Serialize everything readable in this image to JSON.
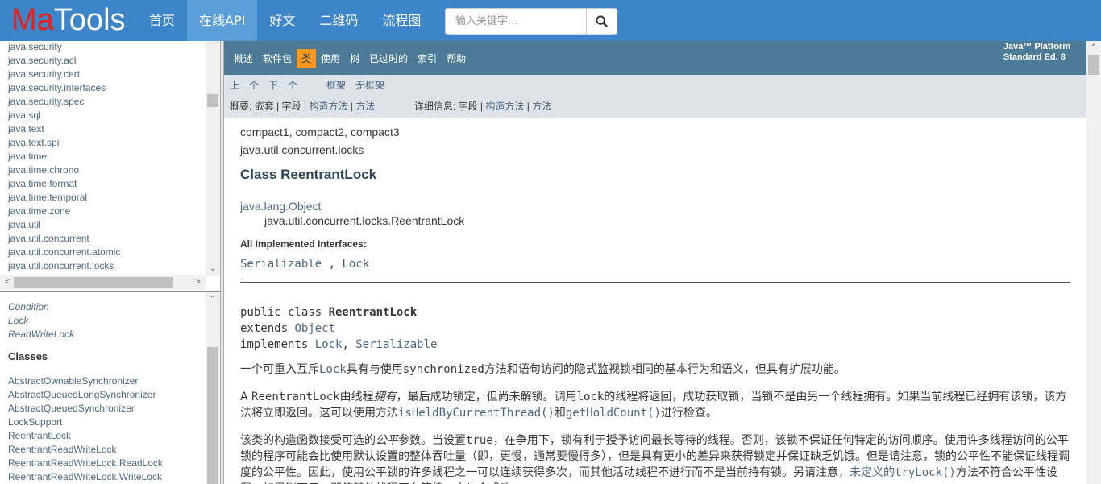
{
  "logo": {
    "ma": "Ma",
    "tools": "Tools"
  },
  "nav": {
    "items": [
      {
        "label": "首页"
      },
      {
        "label": "在线API"
      },
      {
        "label": "好文"
      },
      {
        "label": "二维码"
      },
      {
        "label": "流程图"
      }
    ],
    "active_index": 1
  },
  "search": {
    "placeholder": "输入关键字...",
    "icon": "search-icon"
  },
  "packages": [
    "java.security",
    "java.security.acl",
    "java.security.cert",
    "java.security.interfaces",
    "java.security.spec",
    "java.sql",
    "java.text",
    "java.text.spi",
    "java.time",
    "java.time.chrono",
    "java.time.format",
    "java.time.temporal",
    "java.time.zone",
    "java.util",
    "java.util.concurrent",
    "java.util.concurrent.atomic",
    "java.util.concurrent.locks"
  ],
  "interfaces": [
    "Condition",
    "Lock",
    "ReadWriteLock"
  ],
  "classes_heading": "Classes",
  "classes": [
    "AbstractOwnableSynchronizer",
    "AbstractQueuedLongSynchronizer",
    "AbstractQueuedSynchronizer",
    "LockSupport",
    "ReentrantLock",
    "ReentrantReadWriteLock",
    "ReentrantReadWriteLock.ReadLock",
    "ReentrantReadWriteLock.WriteLock"
  ],
  "docnav": {
    "items": [
      "概述",
      "软件包",
      "类",
      "使用",
      "树",
      "已过时的",
      "索引",
      "帮助"
    ],
    "active_index": 2,
    "platform_line1": "Java™ Platform",
    "platform_line2": "Standard Ed. 8"
  },
  "subnav": {
    "prev": "上一个",
    "next": "下一个",
    "frames": "框架",
    "noframes": "无框架",
    "summary_label": "概要:",
    "summary_nested": "嵌套",
    "summary_sep": "|",
    "summary_field": "字段",
    "summary_constr": "构造方法",
    "summary_method": "方法",
    "detail_label": "详细信息:",
    "detail_field": "字段",
    "detail_constr": "构造方法",
    "detail_method": "方法"
  },
  "content": {
    "profiles": "compact1, compact2, compact3",
    "package": "java.util.concurrent.locks",
    "title": "Class ReentrantLock",
    "inherit_parent": "java.lang.Object",
    "inherit_child": "java.util.concurrent.locks.ReentrantLock",
    "impl_title": "All Implemented Interfaces:",
    "impl_1": "Serializable",
    "impl_sep": " , ",
    "impl_2": "Lock",
    "decl_1_prefix": "public class ",
    "decl_1_name": "ReentrantLock",
    "decl_2_prefix": "extends ",
    "decl_2_link": "Object",
    "decl_3_prefix": "implements ",
    "decl_3_link1": "Lock",
    "decl_3_sep": ", ",
    "decl_3_link2": "Serializable",
    "p1_a": "一个可重入互斥",
    "p1_lock": "Lock",
    "p1_b": "具有与使用",
    "p1_sync": "synchronized",
    "p1_c": "方法和语句访问的隐式监视锁相同的基本行为和语义，但具有扩展功能。",
    "p2_a": "A ",
    "p2_rl": "ReentrantLock",
    "p2_b": "由线程",
    "p2_owned": "拥有",
    "p2_c": "，最后成功锁定，但尚未解锁。调用",
    "p2_lock": "lock",
    "p2_d": "的线程将返回，成功获取锁，当锁不是由另一个线程拥有。如果当前线程已经拥有该锁，该方法将立即返回。这可以使用方法",
    "p2_held": "isHeldByCurrentThread()",
    "p2_e": "和",
    "p2_count": "getHoldCount()",
    "p2_f": "进行检查。",
    "p3_a": "该类的构造函数接受可选的",
    "p3_fair": "公平",
    "p3_b": "参数。当设置",
    "p3_true": "true",
    "p3_c": "，在争用下，锁有利于授予访问最长等待的线程。否则，该锁不保证任何特定的访问顺序。使用许多线程访问的公平锁的程序可能会比使用默认设置的整体吞吐量（即，更慢，通常要慢得多），但是具有更小的差异来获得锁定并保证缺乏饥饿。但是请注意，锁的公平性不能保证线程调度的公平性。因此，使用公平锁的许多线程之一可以连续获得多次，而其他活动线程不进行而不是当前持有锁。另请注意，",
    "p3_untimed": "未定义的",
    "p3_trylock": "tryLock()",
    "p3_d": "方法不符合公平性设置。如果锁可用，即使其他线程正在等待，它也会成功。"
  }
}
